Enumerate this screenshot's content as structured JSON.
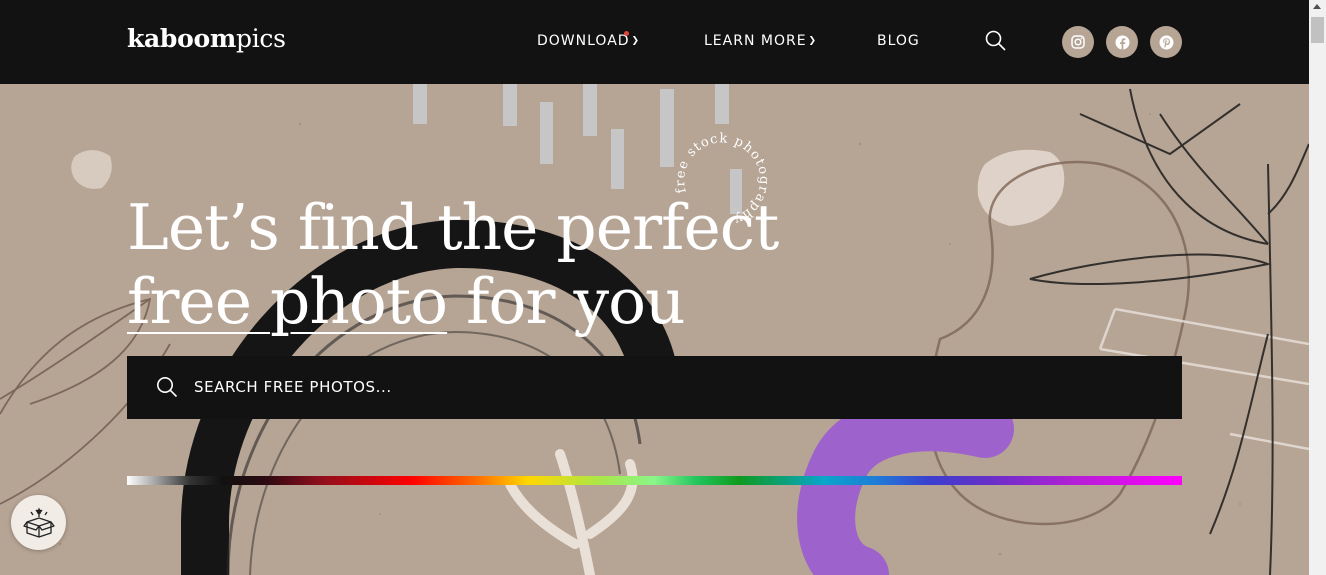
{
  "header": {
    "logo_bold": "kaboom",
    "logo_light": "pics",
    "nav": [
      {
        "label": "DOWNLOAD"
      },
      {
        "label": "LEARN MORE"
      },
      {
        "label": "BLOG"
      }
    ],
    "social": [
      "instagram-icon",
      "facebook-icon",
      "pinterest-icon"
    ]
  },
  "hero": {
    "headline_line1": "Let’s find the perfect",
    "headline_underlined": "free photo",
    "headline_rest": " for you",
    "circle_text": "free stock photography",
    "search": {
      "placeholder": "SEARCH FREE PHOTOS..."
    }
  },
  "colors": {
    "header_bg": "#121212",
    "hero_bg": "#b6a494",
    "accent_dot": "#e0453a",
    "social_bg": "#b6a494"
  }
}
